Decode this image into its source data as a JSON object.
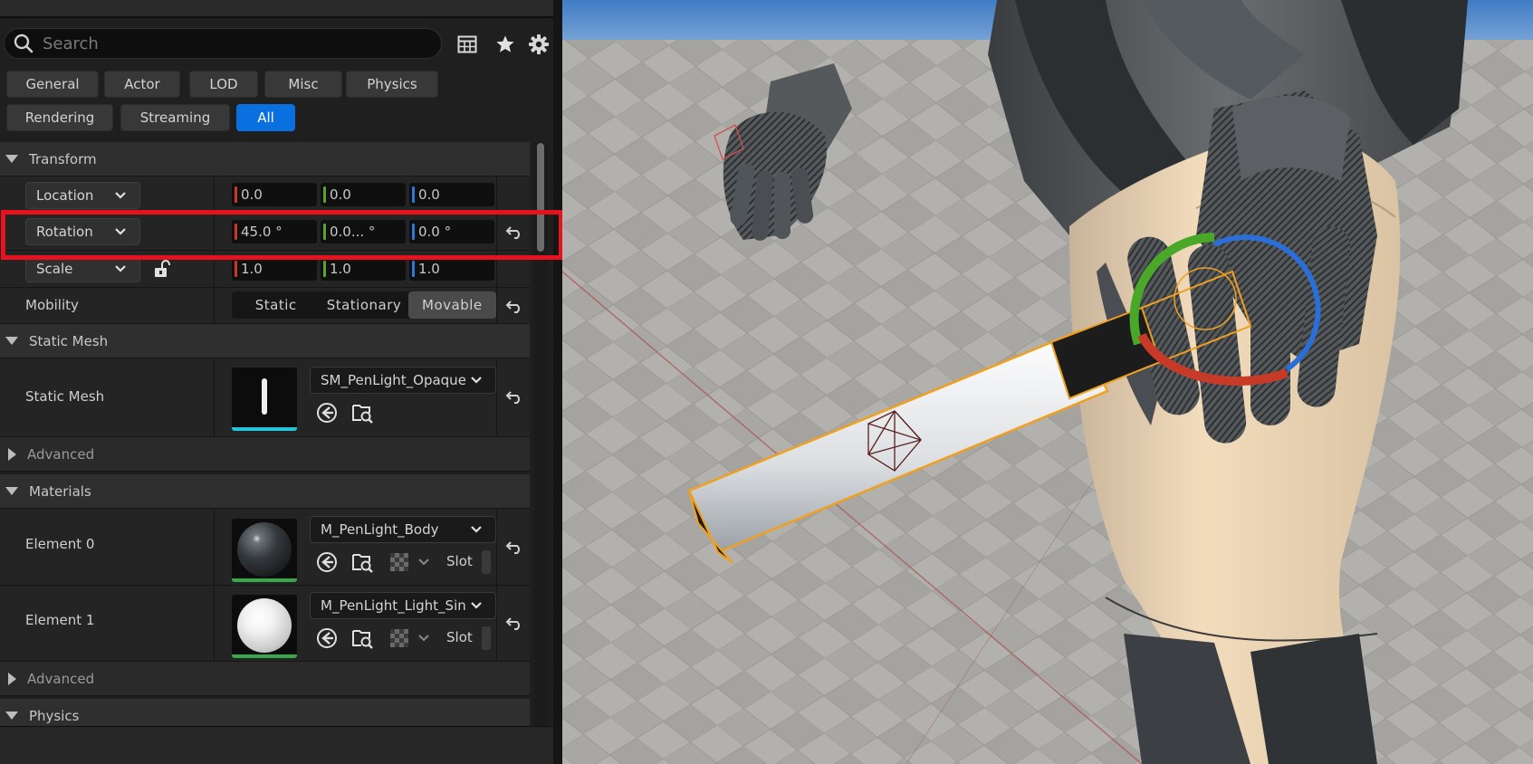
{
  "search": {
    "placeholder": "Search"
  },
  "toolbar_icons": [
    "table-icon",
    "star-icon",
    "gear-icon"
  ],
  "filters": [
    {
      "label": "General",
      "active": false
    },
    {
      "label": "Actor",
      "active": false
    },
    {
      "label": "LOD",
      "active": false
    },
    {
      "label": "Misc",
      "active": false
    },
    {
      "label": "Physics",
      "active": false
    },
    {
      "label": "Rendering",
      "active": false
    },
    {
      "label": "Streaming",
      "active": false
    },
    {
      "label": "All",
      "active": true
    }
  ],
  "transform": {
    "section_label": "Transform",
    "location": {
      "label": "Location",
      "x": "0.0",
      "y": "0.0",
      "z": "0.0"
    },
    "rotation": {
      "label": "Rotation",
      "x": "45.0 °",
      "y": "0.0... °",
      "z": "0.0 °"
    },
    "scale": {
      "label": "Scale",
      "x": "1.0",
      "y": "1.0",
      "z": "1.0"
    },
    "mobility": {
      "label": "Mobility",
      "options": [
        "Static",
        "Stationary",
        "Movable"
      ],
      "selected": "Movable"
    }
  },
  "static_mesh": {
    "section_label": "Static Mesh",
    "row_label": "Static Mesh",
    "asset": "SM_PenLight_Opaque",
    "advanced_label": "Advanced"
  },
  "materials": {
    "section_label": "Materials",
    "elements": [
      {
        "label": "Element 0",
        "asset": "M_PenLight_Body",
        "slot": "Slot"
      },
      {
        "label": "Element 1",
        "asset": "M_PenLight_Light_Single",
        "slot": "Slot"
      }
    ],
    "advanced_label": "Advanced"
  },
  "physics": {
    "section_label": "Physics"
  },
  "colors": {
    "accent": "#0a70e0",
    "highlight": "#e8121e",
    "axis_x": "#c83a28",
    "axis_y": "#5aa428",
    "axis_z": "#2c78d8",
    "selection_outline": "#f0a020"
  }
}
